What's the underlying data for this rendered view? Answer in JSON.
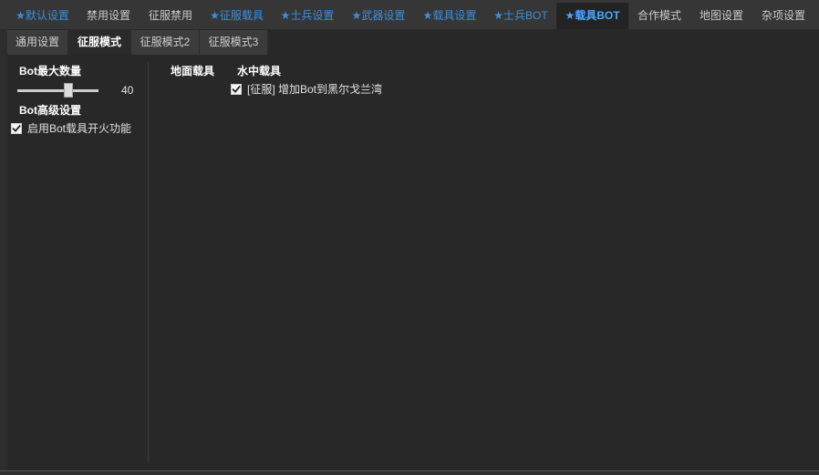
{
  "top_tabs": [
    {
      "label": "★默认设置",
      "selected": false
    },
    {
      "label": "禁用设置",
      "selected": false
    },
    {
      "label": "征服禁用",
      "selected": false
    },
    {
      "label": "★征服载具",
      "selected": false
    },
    {
      "label": "★士兵设置",
      "selected": false
    },
    {
      "label": "★武器设置",
      "selected": false
    },
    {
      "label": "★载具设置",
      "selected": false
    },
    {
      "label": "★士兵BOT",
      "selected": false
    },
    {
      "label": "★载具BOT",
      "selected": true
    },
    {
      "label": "合作模式",
      "selected": false
    },
    {
      "label": "地图设置",
      "selected": false
    },
    {
      "label": "杂项设置",
      "selected": false
    }
  ],
  "sub_tabs": [
    {
      "label": "通用设置",
      "selected": false
    },
    {
      "label": "征服模式",
      "selected": true
    },
    {
      "label": "征服模式2",
      "selected": false
    },
    {
      "label": "征服模式3",
      "selected": false
    }
  ],
  "left_panel": {
    "bot_max_title": "Bot最大数量",
    "bot_max_value": "40",
    "bot_max_level": 0.63,
    "advanced_title": "Bot高级设置",
    "enable_fire_label": "启用Bot载具开火功能",
    "enable_fire_checked": true
  },
  "right_panel": {
    "ground_vehicles_title": "地面载具",
    "water_vehicles_title": "水中载具",
    "options": [
      {
        "label": "[征服] 增加Bot到黑尔戈兰湾",
        "checked": true
      }
    ]
  },
  "colors": {
    "starred_tab_text": "#3d8edb",
    "active_tab_text": "#4aa6ff",
    "panel_background": "#282828"
  },
  "icons": {
    "checkbox_mark": "checkmark-icon"
  }
}
